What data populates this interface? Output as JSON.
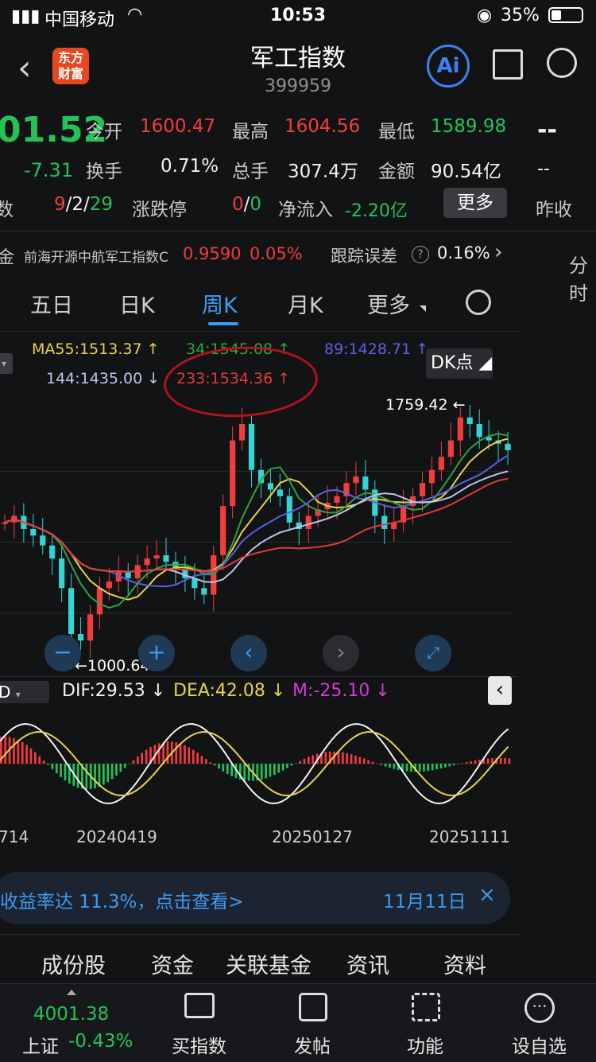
{
  "status": {
    "carrier": "中国移动",
    "time": "10:53",
    "battery": "35%"
  },
  "header": {
    "title": "军工指数",
    "code": "399959",
    "logo": "东方\n财富",
    "ai_label": "Ai"
  },
  "quote": {
    "price": "01.52",
    "change": "-7.31",
    "change_prefix": "-",
    "open_label": "今开",
    "open": "1600.47",
    "high_label": "最高",
    "high": "1604.56",
    "low_label": "最低",
    "low": "1589.98",
    "right_top": "--",
    "turnover_label": "换手",
    "turnover": "0.71%",
    "volume_label": "总手",
    "volume": "307.4万",
    "amount_label": "金额",
    "amount": "90.54亿",
    "right_mid": "--",
    "left_lbl": "数",
    "ups": "9",
    "flat": "2",
    "downs": "29",
    "limit_label": "涨跌停",
    "limit_up": "0",
    "limit_down": "0",
    "netflow_label": "净流入",
    "netflow": "-2.20亿",
    "more_btn": "更多",
    "prev_close_label": "昨收"
  },
  "fund": {
    "prefix": "金",
    "name": "前海开源中航军工指数C",
    "price": "0.9590",
    "pct": "0.05%",
    "err_label": "跟踪误差",
    "err_icon": "help-icon",
    "err": "0.16%",
    "side": "分时"
  },
  "tabs": {
    "items": [
      "五日",
      "日K",
      "周K",
      "月K",
      "更多"
    ],
    "active": 2
  },
  "ma": {
    "ma55": "MA55:1513.37",
    "ma34": "34:1545.08",
    "ma89": "89:1428.71",
    "ma144": "144:1435.00",
    "ma233": "233:1534.36",
    "dk": "DK点"
  },
  "chart_data": {
    "type": "candlestick",
    "high_label": "1759.42",
    "low_label": "1000.64",
    "x_ticks": [
      "714",
      "20240419",
      "20250127",
      "20251111"
    ],
    "macd": {
      "dif": "DIF:29.53",
      "dea": "DEA:42.08",
      "m": "M:-25.10"
    },
    "prices": [
      1400,
      1420,
      1380,
      1360,
      1330,
      1290,
      1200,
      1060,
      1040,
      1120,
      1200,
      1220,
      1250,
      1230,
      1270,
      1290,
      1300,
      1280,
      1260,
      1230,
      1200,
      1180,
      1300,
      1450,
      1650,
      1700,
      1560,
      1520,
      1500,
      1480,
      1400,
      1380,
      1420,
      1440,
      1460,
      1480,
      1520,
      1540,
      1500,
      1420,
      1380,
      1400,
      1450,
      1480,
      1520,
      1560,
      1600,
      1650,
      1720,
      1700,
      1660,
      1650,
      1640,
      1620
    ]
  },
  "banner": {
    "text": "收益率达 11.3%，点击查看>",
    "date": "11月11日"
  },
  "bottom_tabs": [
    "成份股",
    "资金",
    "关联基金",
    "资讯",
    "资料"
  ],
  "dock": {
    "index_value": "4001.38",
    "index_name": "上证",
    "index_pct": "-0.43%",
    "buy": "买指数",
    "post": "发帖",
    "func": "功能",
    "watch": "设自选"
  }
}
